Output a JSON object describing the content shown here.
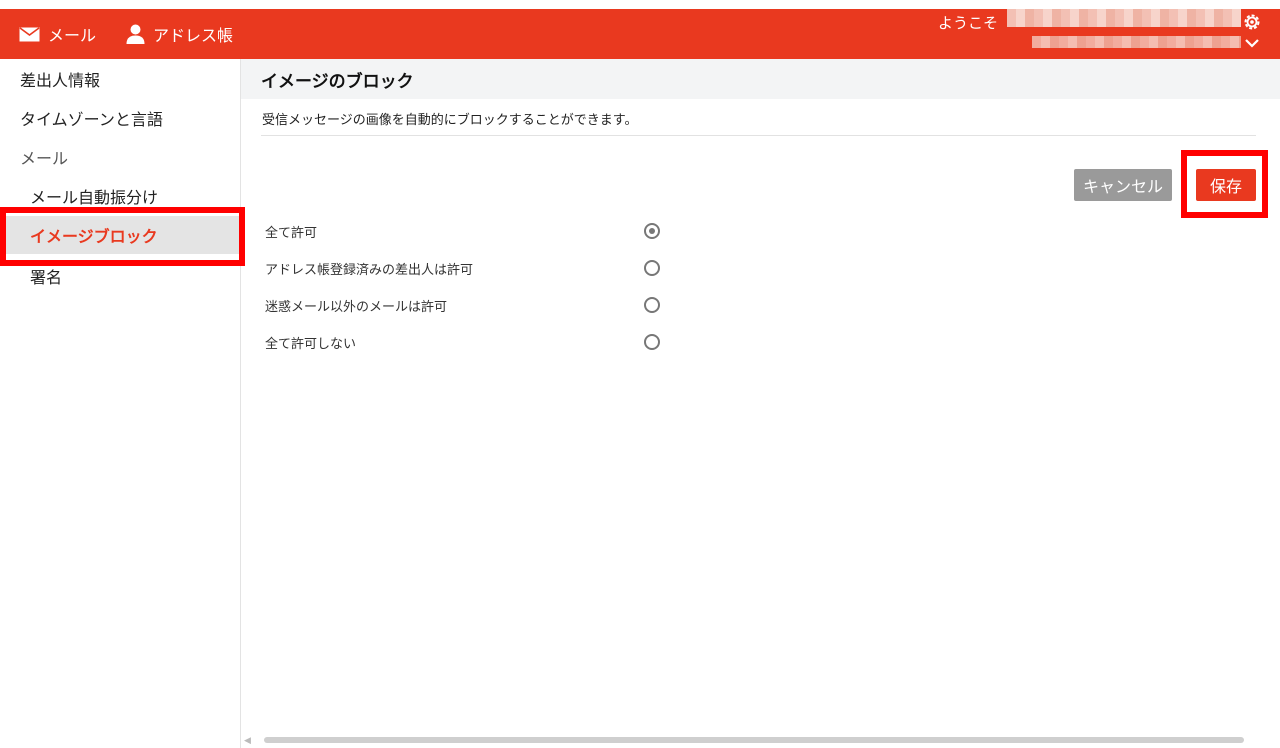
{
  "header": {
    "nav": [
      {
        "label": "メール",
        "icon": "mail-icon"
      },
      {
        "label": "アドレス帳",
        "icon": "person-icon"
      }
    ],
    "welcome_text": "ようこそ",
    "brand_color": "#e9391f"
  },
  "sidebar": {
    "items": [
      {
        "label": "差出人情報"
      },
      {
        "label": "タイムゾーンと言語"
      },
      {
        "label": "メール"
      },
      {
        "label": "メール自動振分け"
      },
      {
        "label": "イメージブロック"
      },
      {
        "label": "署名"
      }
    ],
    "active_item": "イメージブロック"
  },
  "main": {
    "title": "イメージのブロック",
    "description": "受信メッセージの画像を自動的にブロックすることができます。",
    "buttons": {
      "cancel": "キャンセル",
      "save": "保存"
    },
    "options": [
      {
        "label": "全て許可",
        "checked": true
      },
      {
        "label": "アドレス帳登録済みの差出人は許可",
        "checked": false
      },
      {
        "label": "迷惑メール以外のメールは許可",
        "checked": false
      },
      {
        "label": "全て許可しない",
        "checked": false
      }
    ]
  },
  "highlight_color": "#ff0000"
}
